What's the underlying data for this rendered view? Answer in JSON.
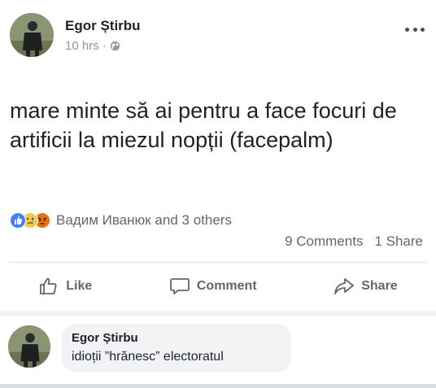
{
  "post": {
    "author": "Egor Știrbu",
    "time": "10 hrs",
    "separator": "·",
    "privacy_icon": "globe-icon",
    "more_icon": "more-dots-icon",
    "text": "mare minte să ai pentru a face focuri de artificii la miezul nopții (facepalm)"
  },
  "reactions": {
    "icons": [
      "like-reaction-icon",
      "sad-reaction-icon",
      "angry-reaction-icon"
    ],
    "summary": "Вадим Иванюк and 3 others",
    "comments_count": "9 Comments",
    "shares_count": "1 Share"
  },
  "actions": {
    "like": "Like",
    "comment": "Comment",
    "share": "Share"
  },
  "comment": {
    "author": "Egor Știrbu",
    "text": "idioții ”hrănesc” electoratul"
  },
  "colors": {
    "text": "#1d2129",
    "secondary": "#90949c",
    "action": "#606770",
    "bubble": "#f2f3f5",
    "like_blue": "#4080ff"
  }
}
